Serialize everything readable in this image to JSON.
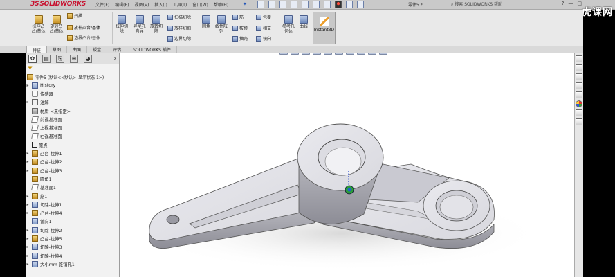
{
  "app": {
    "brand_prefix": "3S",
    "brand_name": "SOLIDWORKS",
    "document_title": "零件5 *",
    "search_placeholder": "搜索 SOLIDWORKS 帮助",
    "watermark": "虎课网"
  },
  "menus": [
    "文件(F)",
    "编辑(E)",
    "视图(V)",
    "插入(I)",
    "工具(T)",
    "窗口(W)",
    "帮助(H)"
  ],
  "ribbon": {
    "large": [
      {
        "label": "拉伸凸\n台/基体",
        "icon": "extrude-boss-icon"
      },
      {
        "label": "旋转凸\n台/基体",
        "icon": "revolve-boss-icon"
      },
      {
        "label": "拉伸切\n除",
        "icon": "extrude-cut-icon"
      },
      {
        "label": "异型孔\n向导",
        "icon": "hole-wizard-icon"
      },
      {
        "label": "旋转切\n除",
        "icon": "revolve-cut-icon"
      },
      {
        "label": "圆角",
        "icon": "fillet-icon"
      },
      {
        "label": "线性阵\n列",
        "icon": "linear-pattern-icon"
      },
      {
        "label": "参考几\n何体",
        "icon": "reference-geometry-icon"
      },
      {
        "label": "曲线",
        "icon": "curves-icon"
      }
    ],
    "small_col1": [
      "扫描",
      "放样凸台/基体",
      "边界凸台/基体"
    ],
    "small_col2": [
      "扫描切除",
      "放样切割",
      "边界切除"
    ],
    "small_col3": [
      "筋",
      "拔模",
      "抽壳"
    ],
    "small_col4": [
      "包覆",
      "相交",
      "镜向"
    ],
    "instant3d": "Instant3D"
  },
  "tabs": [
    "特征",
    "草图",
    "曲面",
    "钣金",
    "评估",
    "SOLIDWORKS 插件"
  ],
  "active_tab": "特征",
  "panel": {
    "root": "零件5 (默认<<默认>_显示状态 1>)",
    "items": [
      {
        "label": "History",
        "icon": "history-icon",
        "expand": "▸"
      },
      {
        "label": "传感器",
        "icon": "sensor-icon",
        "expand": ""
      },
      {
        "label": "注解",
        "icon": "annotations-icon",
        "expand": "▸"
      },
      {
        "label": "材质 <未指定>",
        "icon": "material-icon",
        "expand": ""
      },
      {
        "label": "前视基准面",
        "icon": "plane-icon",
        "expand": ""
      },
      {
        "label": "上视基准面",
        "icon": "plane-icon",
        "expand": ""
      },
      {
        "label": "右视基准面",
        "icon": "plane-icon",
        "expand": ""
      },
      {
        "label": "原点",
        "icon": "origin-icon",
        "expand": ""
      },
      {
        "label": "凸台-拉伸1",
        "icon": "extrude-icon",
        "expand": "▸"
      },
      {
        "label": "凸台-拉伸2",
        "icon": "extrude-icon",
        "expand": "▸"
      },
      {
        "label": "凸台-拉伸3",
        "icon": "extrude-icon",
        "expand": "▸"
      },
      {
        "label": "圆角1",
        "icon": "fillet-icon",
        "expand": ""
      },
      {
        "label": "基准面1",
        "icon": "plane-icon",
        "expand": ""
      },
      {
        "label": "筋1",
        "icon": "rib-icon",
        "expand": "▸"
      },
      {
        "label": "切除-拉伸1",
        "icon": "cut-extrude-icon",
        "expand": "▸"
      },
      {
        "label": "凸台-拉伸4",
        "icon": "extrude-icon",
        "expand": "▸"
      },
      {
        "label": "镜向1",
        "icon": "mirror-icon",
        "expand": ""
      },
      {
        "label": "切除-拉伸2",
        "icon": "cut-extrude-icon",
        "expand": "▸"
      },
      {
        "label": "凸台-拉伸5",
        "icon": "extrude-icon",
        "expand": "▸"
      },
      {
        "label": "切除-拉伸3",
        "icon": "cut-extrude-icon",
        "expand": "▸"
      },
      {
        "label": "切除-拉伸4",
        "icon": "cut-extrude-icon",
        "expand": "▸"
      },
      {
        "label": "大小mm 锥销孔1",
        "icon": "hole-icon",
        "expand": "▸"
      }
    ]
  }
}
